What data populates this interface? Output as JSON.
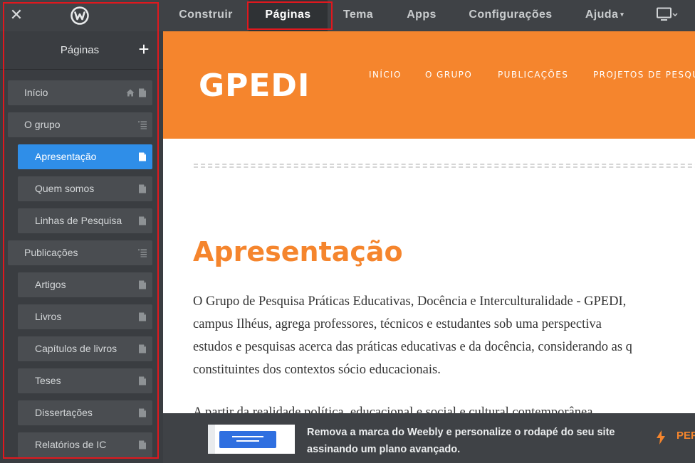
{
  "topbar": {
    "close_label": "✕",
    "nav": [
      {
        "label": "Construir"
      },
      {
        "label": "Páginas"
      },
      {
        "label": "Tema"
      },
      {
        "label": "Apps"
      },
      {
        "label": "Configurações"
      },
      {
        "label": "Ajuda",
        "caret": "▾"
      }
    ],
    "device_icon": "monitor-icon"
  },
  "sidebar": {
    "title": "Páginas",
    "add_label": "+",
    "items": [
      {
        "label": "Início",
        "icons": [
          "home-icon",
          "page-icon"
        ]
      },
      {
        "label": "O grupo",
        "icons": [
          "folder-list-icon"
        ]
      },
      {
        "label": "Apresentação",
        "icons": [
          "page-icon"
        ],
        "active": true
      },
      {
        "label": "Quem somos",
        "icons": [
          "page-icon"
        ]
      },
      {
        "label": "Linhas de Pesquisa",
        "icons": [
          "page-icon"
        ]
      },
      {
        "label": "Publicações",
        "icons": [
          "folder-list-icon"
        ]
      },
      {
        "label": "Artigos",
        "icons": [
          "page-icon"
        ]
      },
      {
        "label": "Livros",
        "icons": [
          "page-icon"
        ]
      },
      {
        "label": "Capítulos de livros",
        "icons": [
          "page-icon"
        ]
      },
      {
        "label": "Teses",
        "icons": [
          "page-icon"
        ]
      },
      {
        "label": "Dissertações",
        "icons": [
          "page-icon"
        ]
      },
      {
        "label": "Relatórios de IC",
        "icons": [
          "page-icon"
        ]
      }
    ]
  },
  "site": {
    "logo": "GPEDI",
    "nav": [
      "INÍCIO",
      "O GRUPO",
      "PUBLICAÇÕES",
      "PROJETOS DE PESQUISA"
    ],
    "heading": "Apresentação",
    "paragraph_lines": [
      "O Grupo de Pesquisa Práticas Educativas, Docência e Interculturalidade - GPEDI,",
      "campus Ilhéus, agrega professores, técnicos e estudantes sob uma perspectiva",
      "estudos e pesquisas acerca das práticas educativas e da docência, considerando as q",
      "constituintes dos contextos sócio educacionais."
    ],
    "partial_line": "A partir da realidade política, educacional e social e cultural contemporânea,"
  },
  "banner": {
    "line1": "Remova a marca do Weebly e personalize o rodapé do seu site",
    "line2": "assinando um plano avançado.",
    "cta": "PERSONALIZAR"
  },
  "colors": {
    "accent_orange": "#f5852d",
    "active_blue": "#2f8ee8",
    "highlight_red": "#e0181e"
  }
}
